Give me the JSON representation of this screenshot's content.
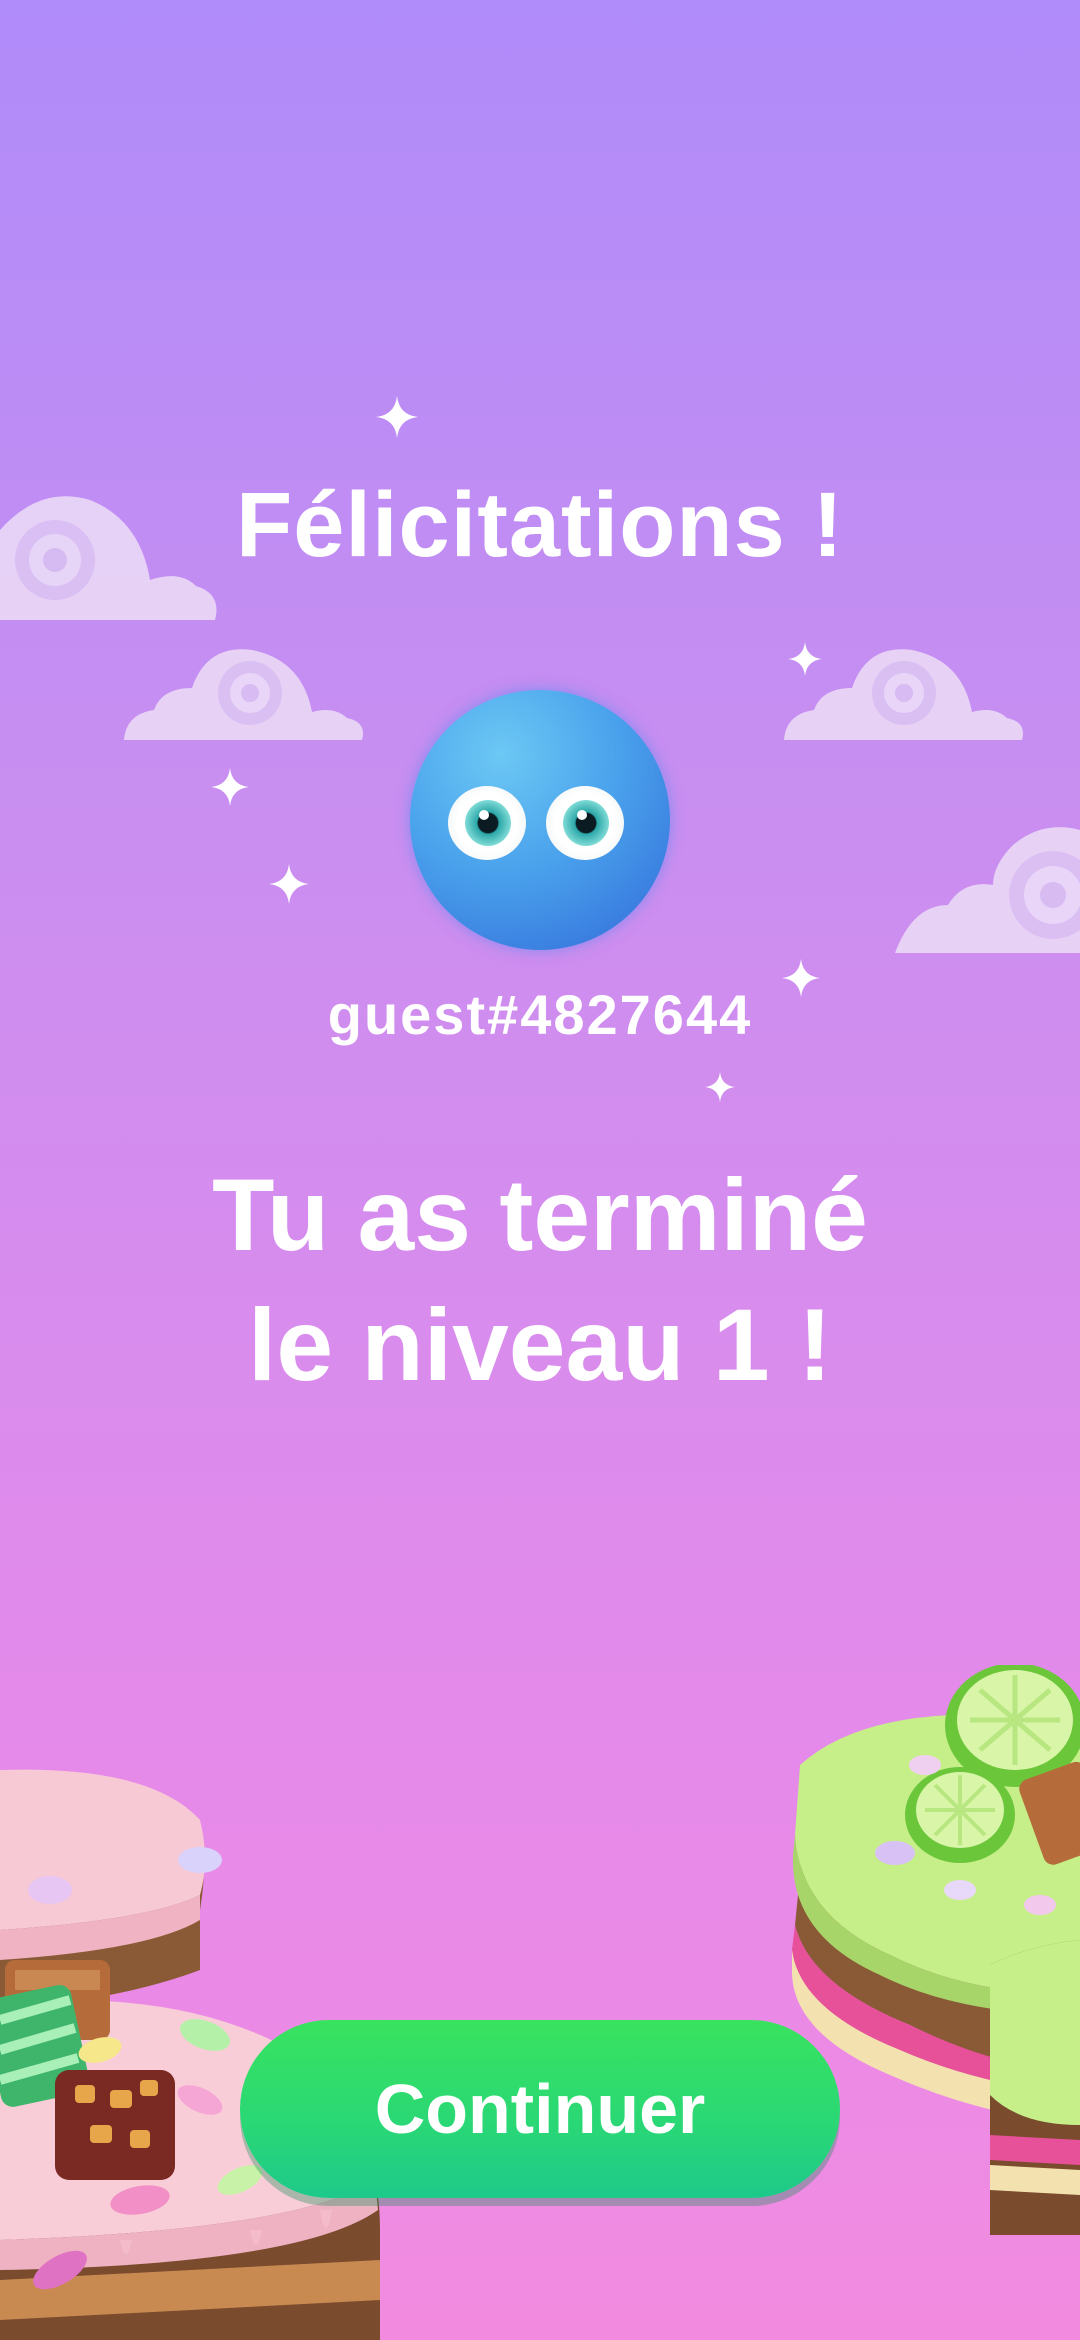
{
  "screen": {
    "title": "Félicitations !",
    "username": "guest#4827644",
    "message_line1": "Tu as terminé",
    "message_line2": "le niveau 1 !",
    "continue_label": "Continuer"
  },
  "colors": {
    "background_top": "#b08bfa",
    "background_bottom": "#f28be0",
    "button": "#2ad86f",
    "text": "#ffffff",
    "avatar": "#4aa2ec"
  },
  "icons": {
    "avatar": "blue-blob-character-icon",
    "sparkle": "sparkle-icon",
    "cloud": "swirl-cloud-icon",
    "cake": "candy-cake-island-icon"
  }
}
